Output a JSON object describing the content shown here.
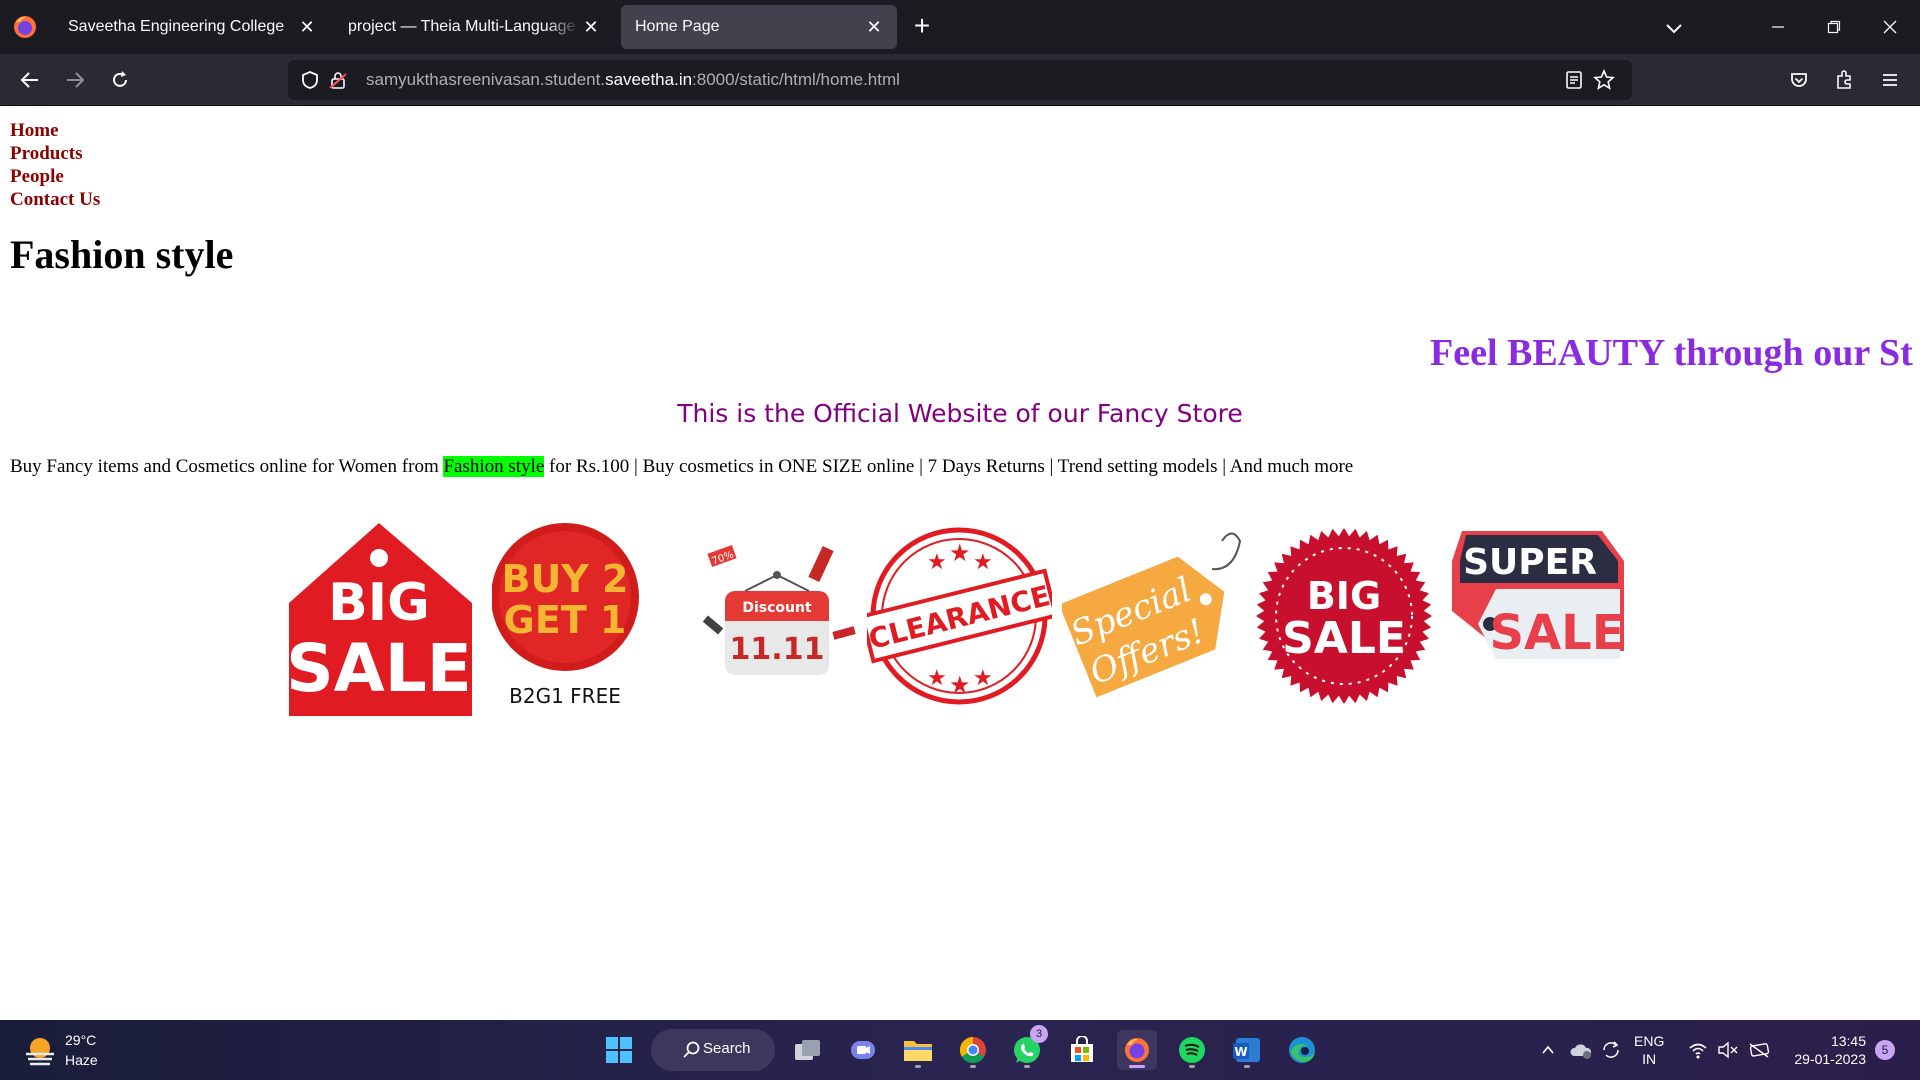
{
  "browser": {
    "tabs": [
      {
        "label": "Saveetha Engineering College"
      },
      {
        "label": "project — Theia Multi-Language Ex"
      },
      {
        "label": "Home Page"
      }
    ],
    "url": {
      "prefix": "samyukthasreenivasan.student.",
      "host": "saveetha.in",
      "suffix": ":8000/static/html/home.html"
    }
  },
  "page": {
    "nav": [
      "Home",
      "Products",
      "People",
      "Contact Us"
    ],
    "title": "Fashion style",
    "marquee": "Feel BEAUTY through our St",
    "official": "This is the Official Website of our Fancy Store",
    "desc_before": "Buy Fancy items and Cosmetics online for Women from ",
    "desc_highlight": "Fashion style",
    "desc_after": " for Rs.100 | Buy cosmetics in ONE SIZE online | 7 Days Returns | Trend setting models | And much more",
    "badges": {
      "big_sale_1": [
        "BIG",
        "SALE"
      ],
      "buy2get1": [
        "BUY 2",
        "GET 1",
        "B2G1 FREE"
      ],
      "discount": [
        "Discount",
        "11.11",
        "70%"
      ],
      "clearance": "CLEARANCE",
      "special": [
        "Special",
        "Offers!"
      ],
      "big_sale_2": [
        "BIG",
        "SALE"
      ],
      "super_sale": [
        "SUPER",
        "SALE"
      ]
    }
  },
  "taskbar": {
    "weather": {
      "temp": "29°C",
      "condition": "Haze"
    },
    "search_label": "Search",
    "whatsapp_badge": "3",
    "lang": [
      "ENG",
      "IN"
    ],
    "time": "13:45",
    "date": "29-01-2023",
    "notif_count": "5"
  },
  "colors": {
    "tabbar": "#1c1b22",
    "navbar": "#2b2a33",
    "nav_link": "#8b0000",
    "marquee": "#8a2be2",
    "official": "#800080",
    "highlight": "#00ff00"
  }
}
